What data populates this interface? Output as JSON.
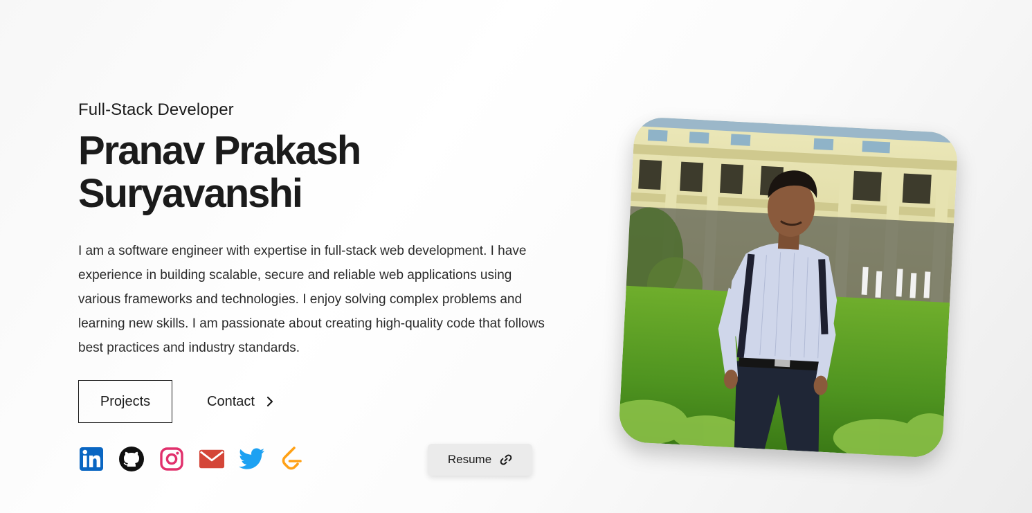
{
  "hero": {
    "subtitle": "Full-Stack Developer",
    "name_line1": "Pranav Prakash",
    "name_line2": "Suryavanshi",
    "bio": "I am a software engineer with expertise in full-stack web development. I have experience in building scalable, secure and reliable web applications using various frameworks and technologies. I enjoy solving complex problems and learning new skills. I am passionate about creating high-quality code that follows best practices and industry standards."
  },
  "actions": {
    "projects_label": "Projects",
    "contact_label": "Contact"
  },
  "socials": [
    {
      "name": "linkedin-icon",
      "color": "#0a66c2"
    },
    {
      "name": "github-icon",
      "color": "#111111"
    },
    {
      "name": "instagram-icon",
      "color": "#e1306c"
    },
    {
      "name": "email-icon",
      "color": "#d44638"
    },
    {
      "name": "twitter-icon",
      "color": "#1da1f2"
    },
    {
      "name": "leetcode-icon",
      "color": "#ffa116"
    }
  ],
  "resume": {
    "label": "Resume",
    "icon": "link-icon"
  },
  "photo": {
    "icon": "profile-photo"
  }
}
